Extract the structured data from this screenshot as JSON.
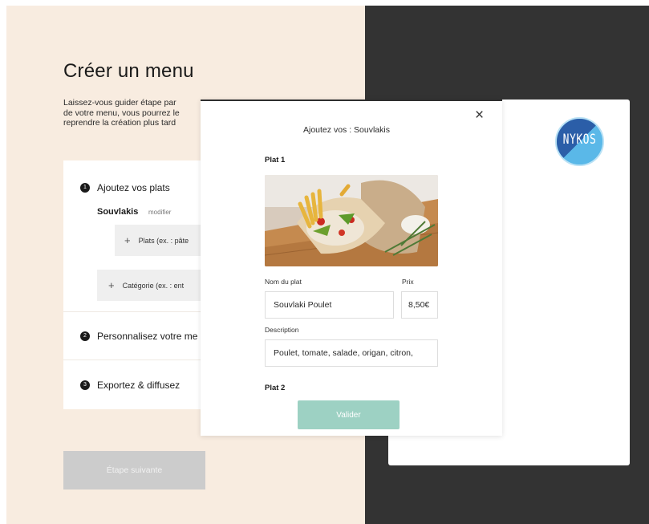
{
  "page": {
    "title": "Créer un menu",
    "intro_lines": [
      "Laissez-vous guider étape par",
      "de votre menu, vous pourrez le",
      "reprendre la création plus tard"
    ]
  },
  "steps": [
    {
      "number": "1",
      "label": "Ajoutez vos plats"
    },
    {
      "number": "2",
      "label": "Personnalisez votre me"
    },
    {
      "number": "3",
      "label": "Exportez & diffusez"
    }
  ],
  "category": {
    "name": "Souvlakis",
    "modify_label": "modifier",
    "add_dish_label": "Plats (ex. : pâte",
    "add_category_label": "Catégorie (ex. : ent"
  },
  "next_button_label": "Étape suivante",
  "modal": {
    "title": "Ajoutez vos : Souvlakis",
    "close_glyph": "×",
    "dish_heading": "Plat 1",
    "next_dish_heading": "Plat 2",
    "name_label": "Nom du plat",
    "name_value": "Souvlaki Poulet",
    "price_label": "Prix",
    "price_value": "8,50€",
    "description_label": "Description",
    "description_value": "Poulet, tomate, salade, origan, citron,",
    "validate_label": "Valider"
  },
  "preview": {
    "logo_text": "NYKOS"
  },
  "colors": {
    "left_background": "#f8ece0",
    "dark_background": "#333333",
    "validate_button": "#9dd1c3",
    "disabled_button": "#cccccc",
    "logo_blue": "#2b5ea8",
    "logo_light_blue": "#5ab8e8"
  },
  "icons": {
    "close": "close-icon",
    "add": "plus-icon",
    "step": "step-number-badge"
  }
}
